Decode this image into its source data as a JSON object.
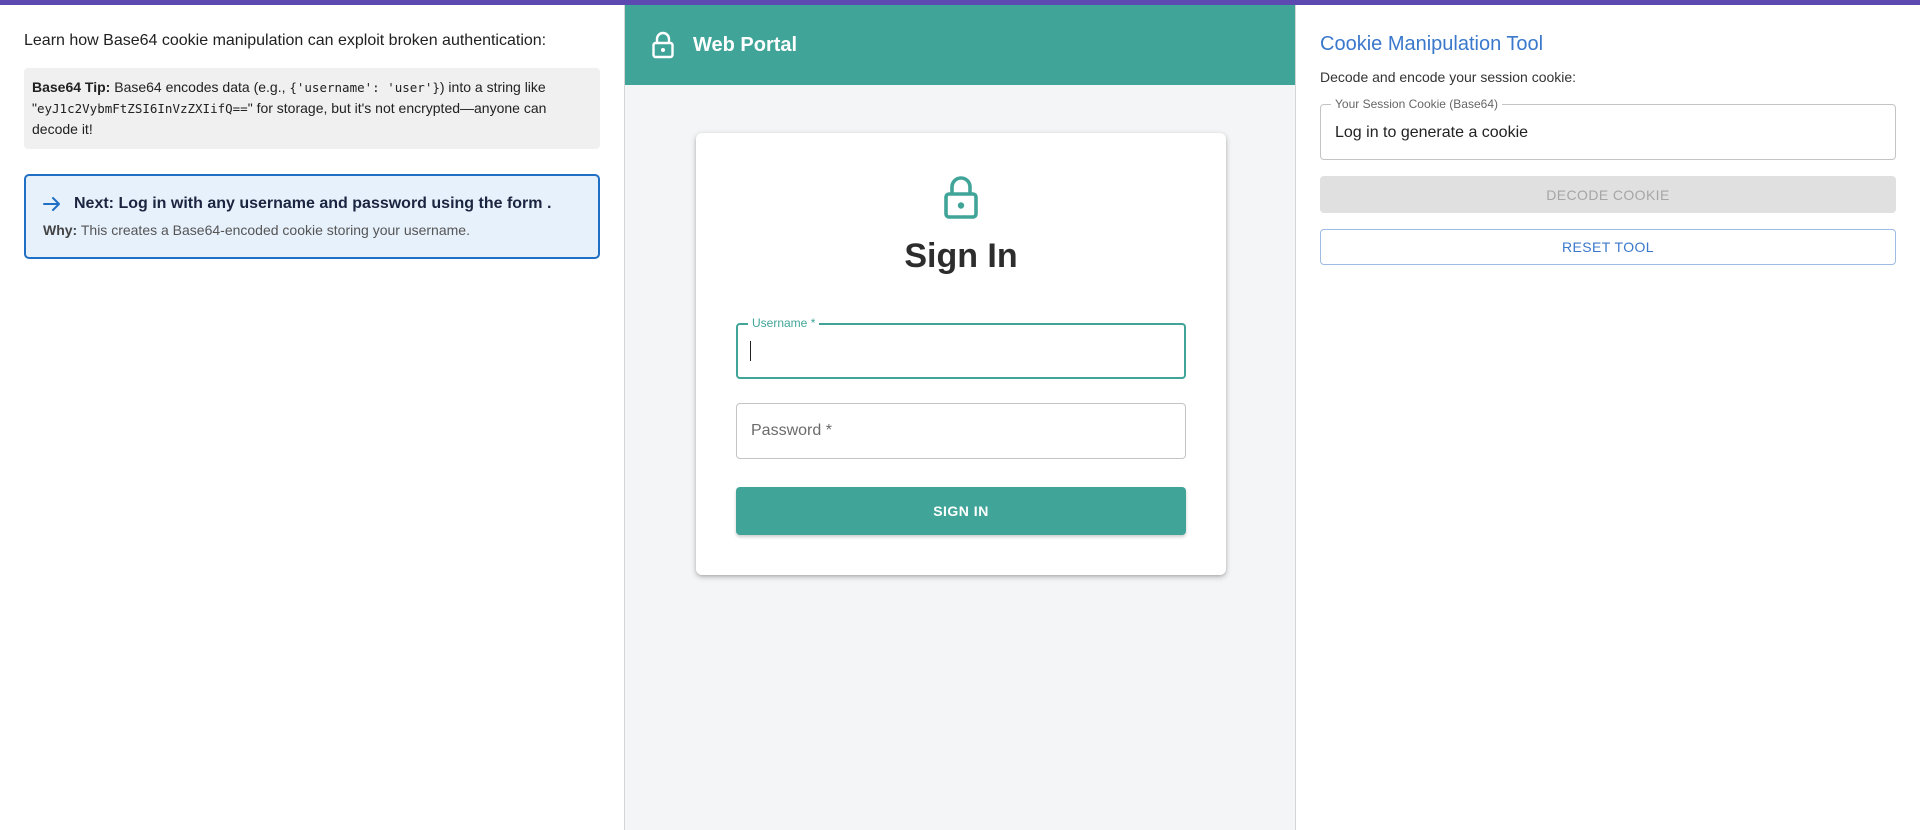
{
  "colors": {
    "accent_purple": "#5c4ab0",
    "teal": "#40a598",
    "blue": "#3a78cc",
    "info_border": "#1f6fc4",
    "info_bg": "#e7f1fc"
  },
  "left": {
    "intro": "Learn how Base64 cookie manipulation can exploit broken authentication:",
    "tip": {
      "label": "Base64 Tip:",
      "text_1": " Base64 encodes data (e.g., ",
      "code_1": "{'username': 'user'}",
      "text_2": ") into a string like \"",
      "code_2": "eyJ1c2VybmFtZSI6InVzZXIifQ==",
      "text_3": "\" for storage, but it's not encrypted—anyone can decode it!"
    },
    "next": {
      "icon": "arrow-right-icon",
      "text": "Next: Log in with any username and password using the form .",
      "why_label": "Why:",
      "why_text": " This creates a Base64-encoded cookie storing your username."
    }
  },
  "center": {
    "app_title": "Web Portal",
    "app_icon": "lock-icon",
    "card_title": "Sign In",
    "username_label": "Username *",
    "password_placeholder": "Password *",
    "sign_in_label": "SIGN IN"
  },
  "right": {
    "title": "Cookie Manipulation Tool",
    "subtitle": "Decode and encode your session cookie:",
    "cookie_label": "Your Session Cookie (Base64)",
    "cookie_value": "Log in to generate a cookie",
    "decode_label": "DECODE COOKIE",
    "reset_label": "RESET TOOL"
  }
}
